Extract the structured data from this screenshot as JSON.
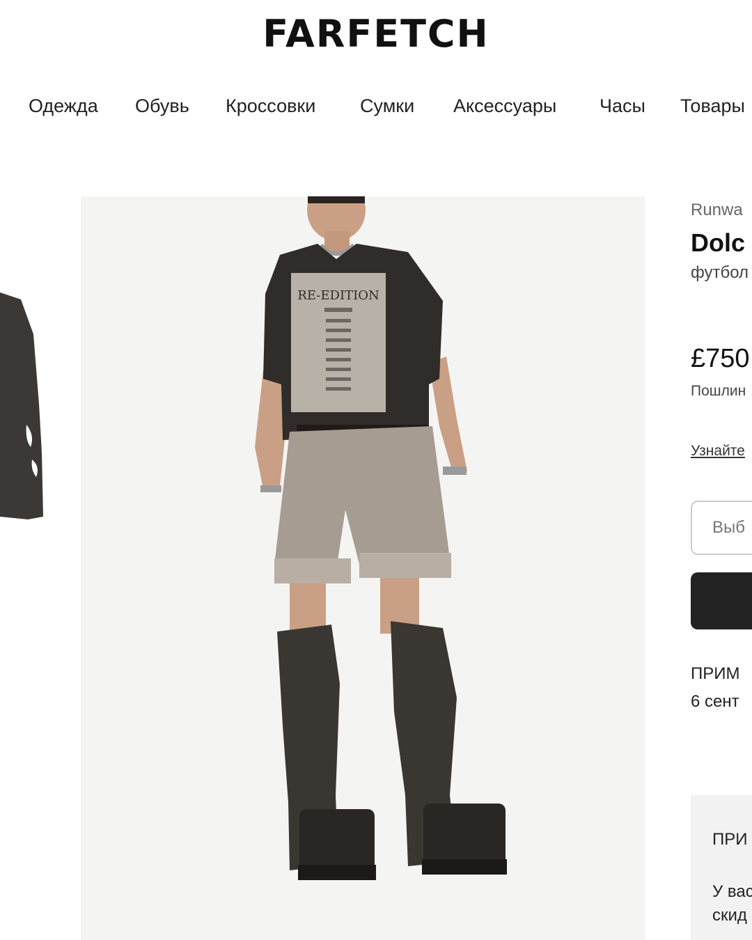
{
  "header": {
    "logo": "FARFETCH"
  },
  "nav": {
    "items": [
      {
        "label": "Одежда"
      },
      {
        "label": "Обувь"
      },
      {
        "label": "Кроссовки"
      },
      {
        "label": "Сумки"
      },
      {
        "label": "Аксессуары"
      },
      {
        "label": "Часы"
      },
      {
        "label": "Товары"
      }
    ]
  },
  "product": {
    "badge": "Runwa",
    "brand": "Dolc",
    "description": "футбол",
    "price": "£750",
    "duty_note": "Пошлин",
    "learn_more": "Узнайте",
    "size_select": "Выб",
    "note_title": "ПРИМ",
    "note_date": "6 сент",
    "image_tee_text": "RE-EDITION"
  },
  "promo": {
    "title": "ПРИ",
    "line1": "У вас",
    "line2": "скид"
  }
}
